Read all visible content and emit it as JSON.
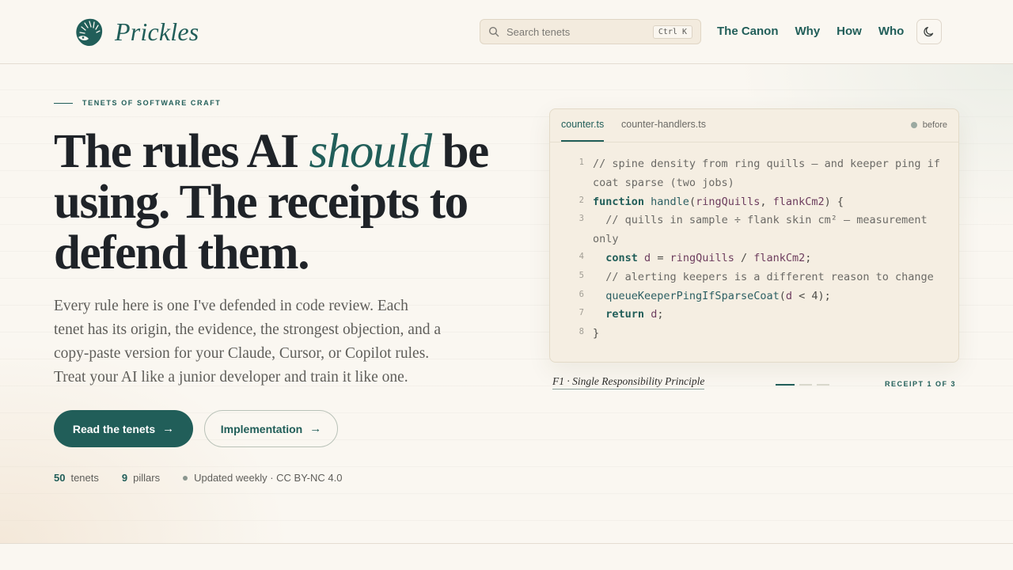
{
  "header": {
    "brand_name": "Prickles",
    "search_placeholder": "Search tenets",
    "search_shortcut": "Ctrl K",
    "nav": [
      "The Canon",
      "Why",
      "How",
      "Who"
    ],
    "theme_toggle_icon": "moon-icon"
  },
  "hero": {
    "eyebrow": "TENETS OF SOFTWARE CRAFT",
    "headline_pre": "The rules AI ",
    "headline_em": "should",
    "headline_post": " be using. The receipts to defend them.",
    "lede": "Every rule here is one I've defended in code review. Each tenet has its origin, the evidence, the strongest objection, and a copy-paste version for your Claude, Cursor, or Copilot rules. Treat your AI like a junior developer and train it like one.",
    "primary_button": "Read the tenets",
    "secondary_button": "Implementation",
    "stats": {
      "tenets_count": "50",
      "tenets_label": "tenets",
      "pillars_count": "9",
      "pillars_label": "pillars",
      "updated": "Updated weekly · CC BY-NC 4.0"
    }
  },
  "code_card": {
    "tabs": [
      "counter.ts",
      "counter-handlers.ts"
    ],
    "active_tab": "counter.ts",
    "status": "before",
    "lines": [
      {
        "n": "1",
        "text": "// spine density from ring quills — and keeper ping if coat sparse (two jobs)"
      },
      {
        "n": "2",
        "text": "function handle(ringQuills, flankCm2) {"
      },
      {
        "n": "3",
        "text": "  // quills in sample ÷ flank skin cm² — measurement only"
      },
      {
        "n": "4",
        "text": "  const d = ringQuills / flankCm2;"
      },
      {
        "n": "5",
        "text": "  // alerting keepers is a different reason to change"
      },
      {
        "n": "6",
        "text": "  queueKeeperPingIfSparseCoat(d < 4);"
      },
      {
        "n": "7",
        "text": "  return d;"
      },
      {
        "n": "8",
        "text": "}"
      }
    ],
    "caption": "F1 · Single Responsibility Principle",
    "receipt": "RECEIPT 1 OF 3",
    "receipt_index": 1,
    "receipt_total": 3
  },
  "colors": {
    "accent": "#215e59",
    "background": "#faf7f1",
    "card": "#f5eee2"
  }
}
